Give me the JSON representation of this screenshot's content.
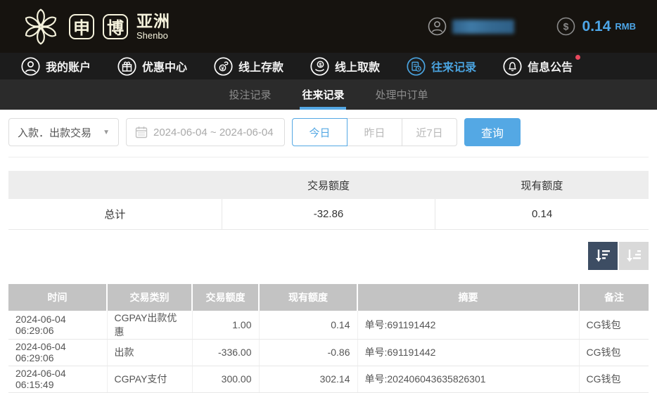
{
  "colors": {
    "accent_blue": "#54a8e4",
    "nav_active_blue": "#4aa3df",
    "balance_blue": "#4da6e8",
    "notification_dot": "#e8485c",
    "sort_active_bg": "#3d4d63",
    "table_header_bg": "#c3c3c3"
  },
  "header": {
    "logo": {
      "char1": "申",
      "char2": "博",
      "region": "亚洲",
      "sub": "Shenbo"
    },
    "balance": {
      "amount": "0.14",
      "currency": "RMB"
    }
  },
  "nav": {
    "items": [
      {
        "label": "我的账户",
        "icon": "user-icon"
      },
      {
        "label": "优惠中心",
        "icon": "gift-icon"
      },
      {
        "label": "线上存款",
        "icon": "deposit-icon"
      },
      {
        "label": "线上取款",
        "icon": "withdraw-icon"
      },
      {
        "label": "往来记录",
        "icon": "records-icon",
        "active": true
      },
      {
        "label": "信息公告",
        "icon": "bell-icon",
        "has_dot": true
      }
    ]
  },
  "subtabs": {
    "items": [
      {
        "label": "投注记录"
      },
      {
        "label": "往来记录",
        "active": true
      },
      {
        "label": "处理中订单"
      }
    ]
  },
  "filters": {
    "type_select": {
      "value": "入款．出款交易"
    },
    "date_range": {
      "value": "2024-06-04 ~ 2024-06-04"
    },
    "quick_buttons": [
      {
        "label": "今日",
        "active": true
      },
      {
        "label": "昨日"
      },
      {
        "label": "近7日"
      }
    ],
    "search_label": "查询"
  },
  "summary": {
    "col_transaction": "交易额度",
    "col_balance": "现有额度",
    "row_label": "总计",
    "transaction_amount": "-32.86",
    "current_balance": "0.14"
  },
  "table": {
    "headers": [
      "时间",
      "交易类别",
      "交易额度",
      "现有额度",
      "摘要",
      "备注"
    ],
    "rows": [
      [
        "2024-06-04 06:29:06",
        "CGPAY出款优惠",
        "1.00",
        "0.14",
        "单号:691191442",
        "CG钱包"
      ],
      [
        "2024-06-04 06:29:06",
        "出款",
        "-336.00",
        "-0.86",
        "单号:691191442",
        "CG钱包"
      ],
      [
        "2024-06-04 06:15:49",
        "CGPAY支付",
        "300.00",
        "302.14",
        "单号:202406043635826301",
        "CG钱包"
      ]
    ]
  }
}
